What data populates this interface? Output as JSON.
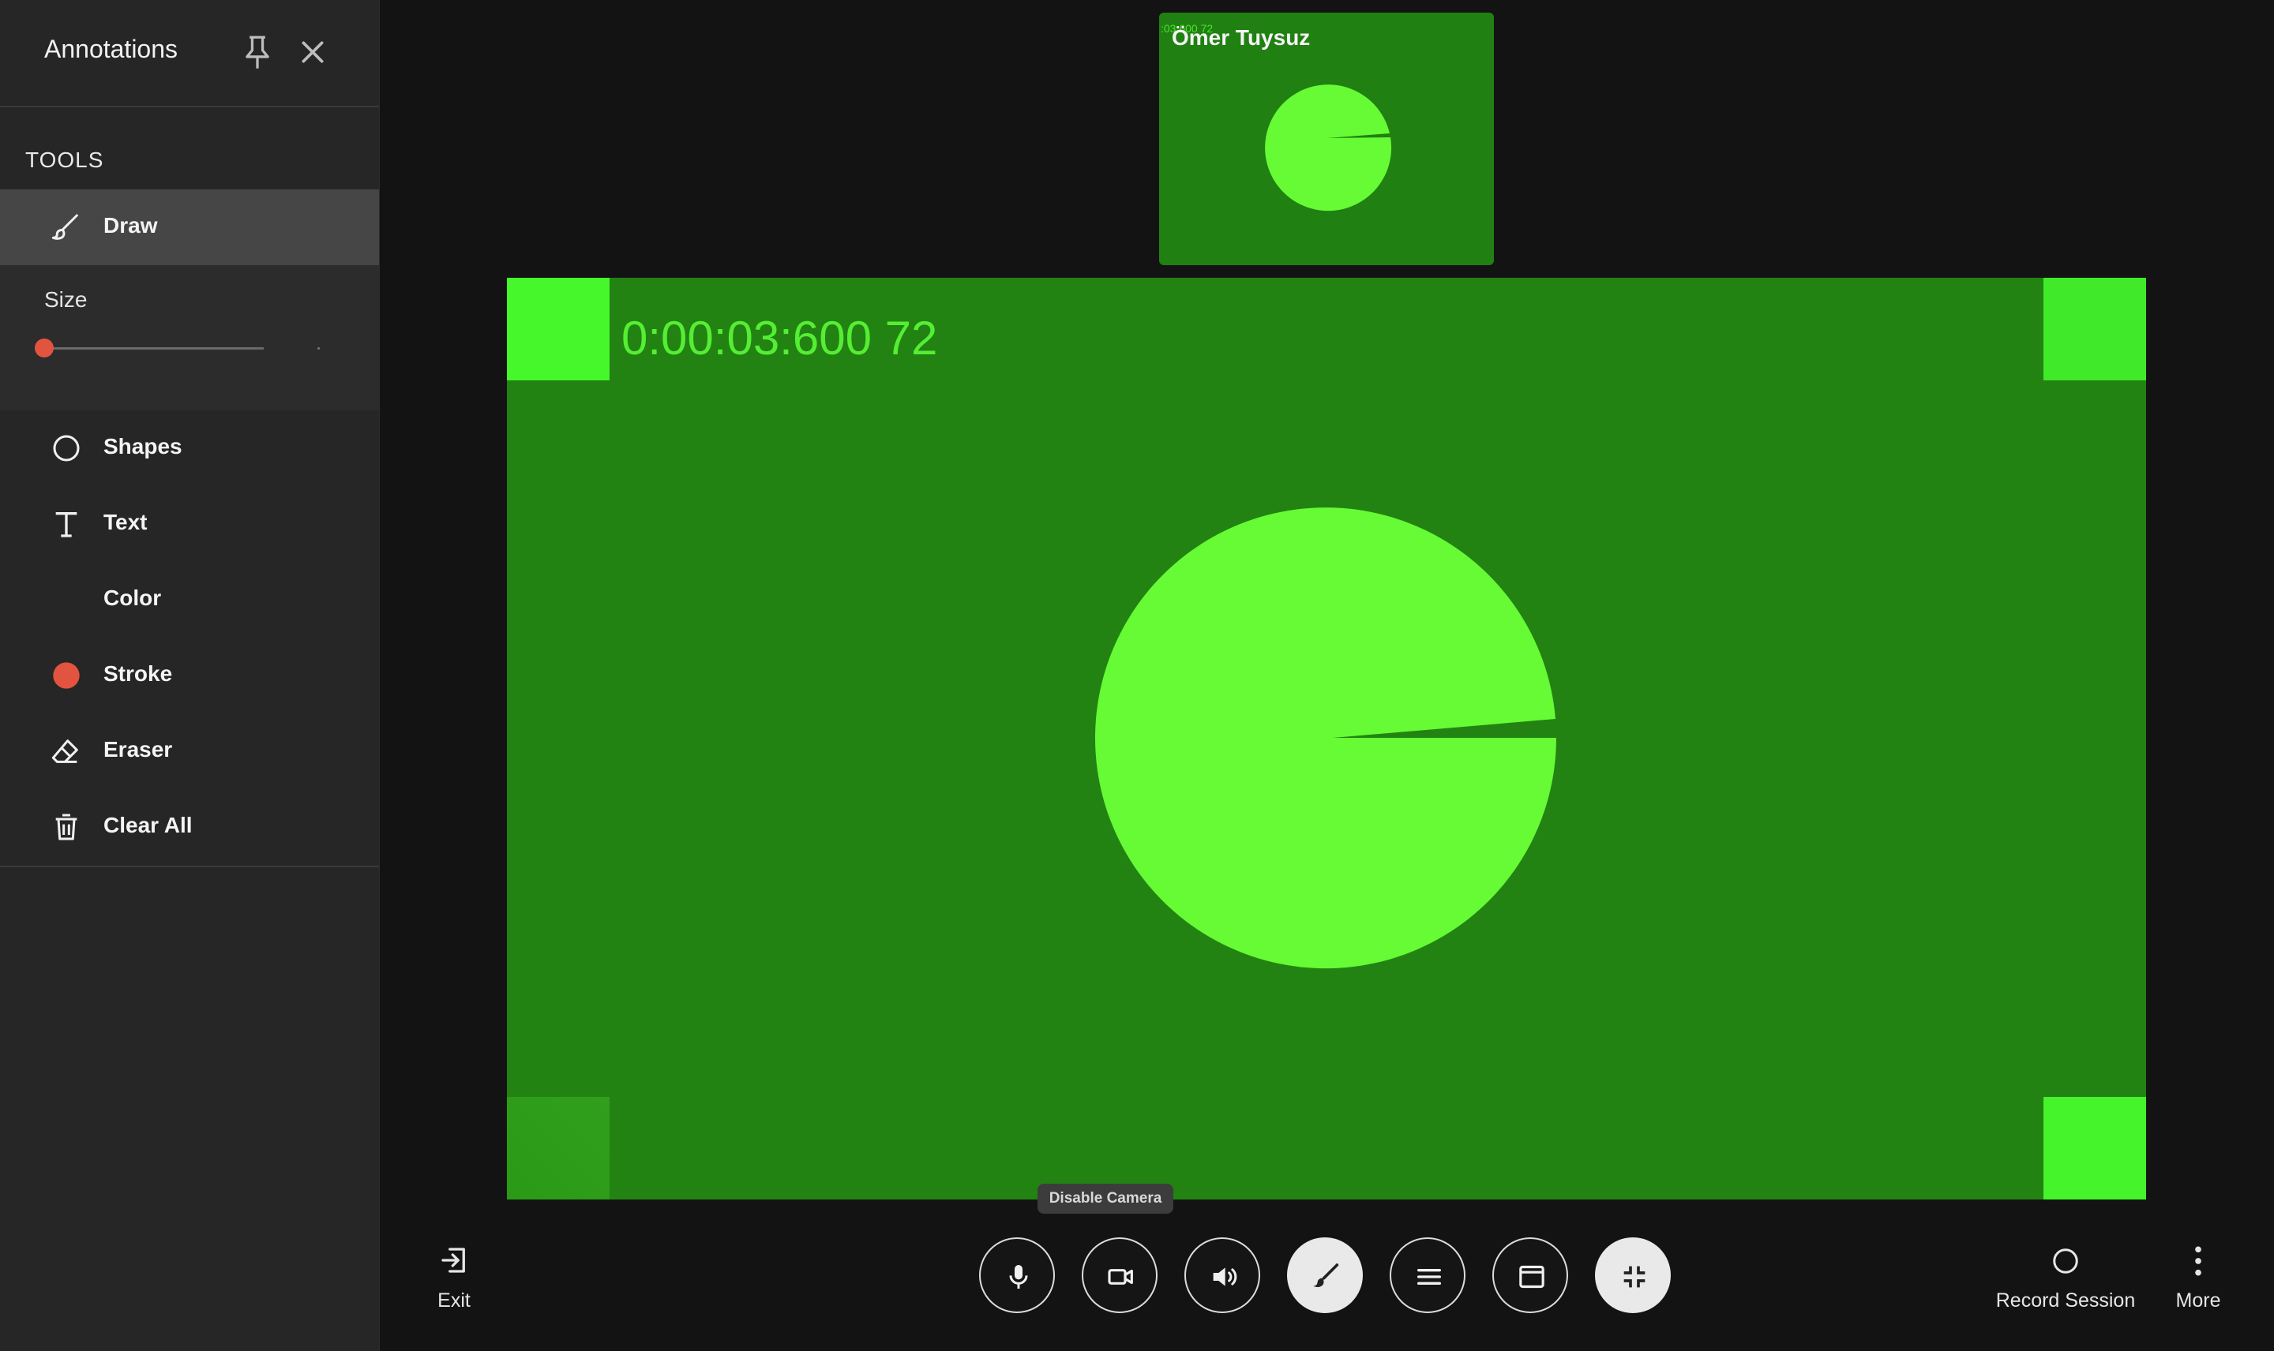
{
  "annotations_panel": {
    "title": "Annotations",
    "tools_heading": "TOOLS",
    "tools": {
      "draw": "Draw",
      "size": "Size",
      "shapes": "Shapes",
      "text": "Text",
      "color": "Color",
      "stroke": "Stroke",
      "eraser": "Eraser",
      "clear_all": "Clear All"
    },
    "size_value": 0,
    "stroke_color": "#e2543f",
    "icons": {
      "pin": "pin-icon",
      "close": "close-icon",
      "draw": "brush-icon",
      "shapes": "circle-icon",
      "text": "text-icon",
      "stroke": "stroke-color-icon",
      "eraser": "eraser-icon",
      "clear_all": "trash-icon"
    }
  },
  "self_view": {
    "name": "Ömer Tuysuz",
    "timestamp": ":03:600 72"
  },
  "main_video": {
    "timestamp": "0:00:03:600 72",
    "background_color": "#228312",
    "accent_color": "#66fb34"
  },
  "tooltip": "Disable Camera",
  "controls": {
    "exit_label": "Exit",
    "record_label": "Record Session",
    "more_label": "More",
    "buttons": [
      "mic-icon",
      "camera-icon",
      "speaker-icon",
      "brush-icon",
      "menu-icon",
      "window-icon",
      "exit-fullscreen-icon"
    ],
    "active": [
      "brush-icon",
      "exit-fullscreen-icon"
    ]
  }
}
